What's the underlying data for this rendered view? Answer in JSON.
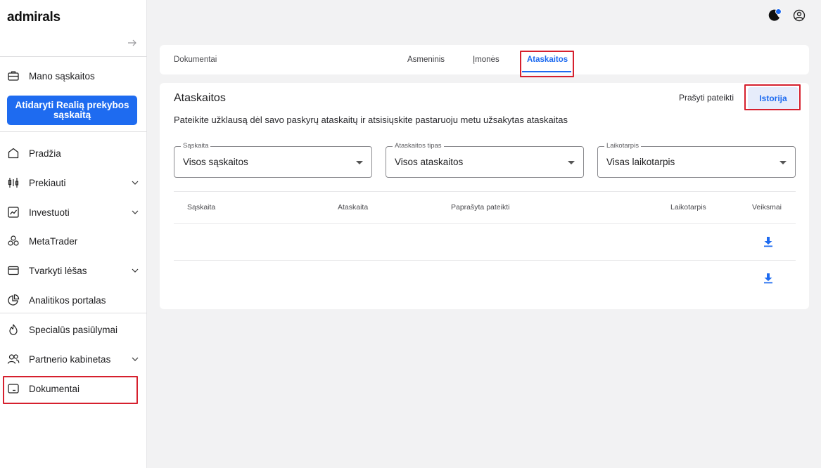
{
  "brand": {
    "logo": "admirals"
  },
  "sidebar": {
    "account_item": "Mano sąskaitos",
    "open_button": "Atidaryti Realią prekybos sąskaitą",
    "items": [
      {
        "label": "Pradžia",
        "icon": "home-icon"
      },
      {
        "label": "Prekiauti",
        "icon": "candlestick-icon"
      },
      {
        "label": "Investuoti",
        "icon": "chart-line-icon"
      },
      {
        "label": "MetaTrader",
        "icon": "metatrader-icon"
      },
      {
        "label": "Tvarkyti lėšas",
        "icon": "wallet-icon"
      },
      {
        "label": "Analitikos portalas",
        "icon": "pie-chart-icon"
      },
      {
        "label": "Specialūs pasiūlymai",
        "icon": "flame-icon"
      },
      {
        "label": "Partnerio kabinetas",
        "icon": "partners-icon"
      },
      {
        "label": "Dokumentai",
        "icon": "folder-icon"
      }
    ]
  },
  "tabs": {
    "title": "Dokumentai",
    "items": [
      {
        "label": "Asmeninis"
      },
      {
        "label": "Įmonės"
      },
      {
        "label": "Ataskaitos"
      }
    ],
    "active": "Ataskaitos"
  },
  "main": {
    "title": "Ataskaitos",
    "request_button": "Prašyti pateikti",
    "history_button": "Istorija",
    "description": "Pateikite užklausą dėl savo paskyrų ataskaitų ir atsisiųskite pastaruoju metu užsakytas ataskaitas",
    "filters": [
      {
        "label": "Sąskaita",
        "value": "Visos sąskaitos"
      },
      {
        "label": "Ataskaitos tipas",
        "value": "Visos ataskaitos"
      },
      {
        "label": "Laikotarpis",
        "value": "Visas laikotarpis"
      }
    ],
    "table": {
      "headers": [
        "Sąskaita",
        "Ataskaita",
        "Paprašyta pateikti",
        "Laikotarpis",
        "Veiksmai"
      ]
    }
  },
  "colors": {
    "accent": "#1e6bf0",
    "highlight": "#d6202e"
  }
}
